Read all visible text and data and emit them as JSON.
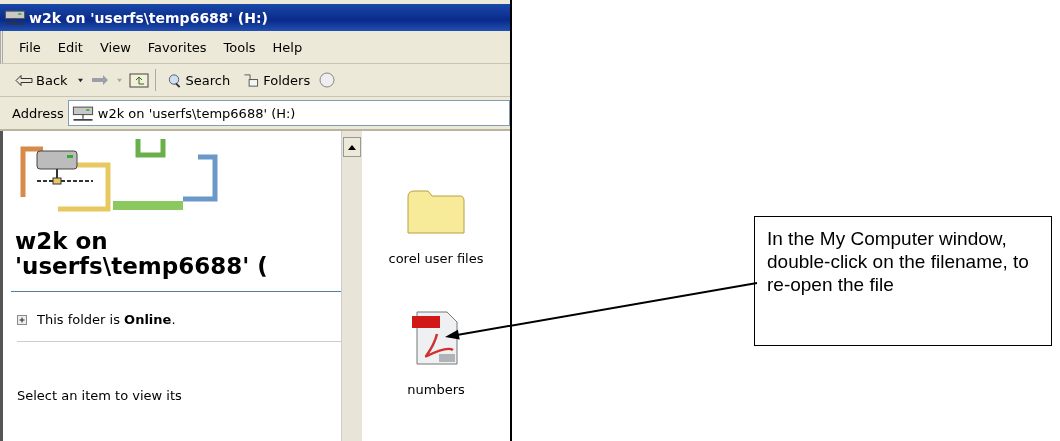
{
  "window": {
    "title": "w2k on 'userfs\\temp6688' (H:)"
  },
  "menu": [
    "File",
    "Edit",
    "View",
    "Favorites",
    "Tools",
    "Help"
  ],
  "toolbar": {
    "back": "Back",
    "search": "Search",
    "folders": "Folders"
  },
  "address": {
    "label": "Address",
    "value": "w2k on 'userfs\\temp6688' (H:)"
  },
  "task_pane": {
    "heading": "w2k on 'userfs\\temp6688' (",
    "status": "This folder is **Online**.",
    "hint": "Select an item to view its"
  },
  "files": [
    {
      "name": "corel user files",
      "kind": "folder"
    },
    {
      "name": "numbers",
      "kind": "pdf"
    }
  ],
  "callout": {
    "text": "In the My Computer window, double-click on the filename, to re-open the file"
  }
}
